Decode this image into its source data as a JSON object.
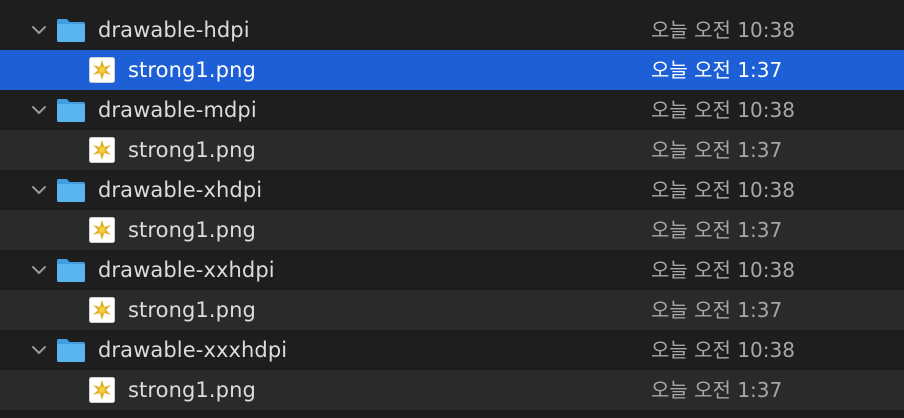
{
  "rows": [
    {
      "kind": "folder",
      "name": "drawable-hdpi",
      "date": "오늘 오전 10:38"
    },
    {
      "kind": "file",
      "name": "strong1.png",
      "date": "오늘 오전 1:37",
      "selected": true
    },
    {
      "kind": "folder",
      "name": "drawable-mdpi",
      "date": "오늘 오전 10:38"
    },
    {
      "kind": "file",
      "name": "strong1.png",
      "date": "오늘 오전 1:37"
    },
    {
      "kind": "folder",
      "name": "drawable-xhdpi",
      "date": "오늘 오전 10:38"
    },
    {
      "kind": "file",
      "name": "strong1.png",
      "date": "오늘 오전 1:37"
    },
    {
      "kind": "folder",
      "name": "drawable-xxhdpi",
      "date": "오늘 오전 10:38"
    },
    {
      "kind": "file",
      "name": "strong1.png",
      "date": "오늘 오전 1:37"
    },
    {
      "kind": "folder",
      "name": "drawable-xxxhdpi",
      "date": "오늘 오전 10:38"
    },
    {
      "kind": "file",
      "name": "strong1.png",
      "date": "오늘 오전 1:37"
    }
  ],
  "colors": {
    "selection": "#1d5fd6",
    "folder": "#5ab4f0",
    "text": "#dcdcdc",
    "date": "#a7a7a7"
  },
  "icons": {
    "disclosure": "chevron-down-icon",
    "folder": "folder-icon",
    "file": "png-image-file-icon"
  }
}
